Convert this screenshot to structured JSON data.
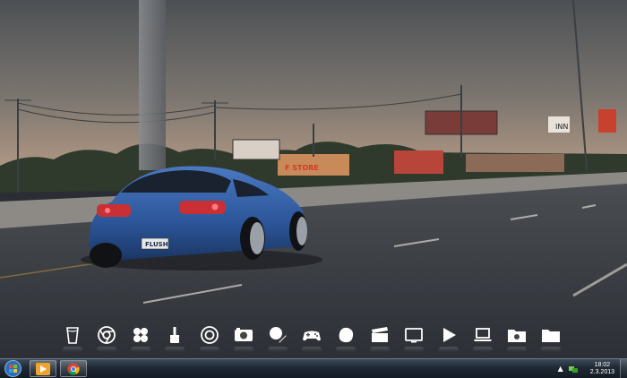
{
  "wallpaper": {
    "description_icon": "wallpaper-image",
    "signs": {
      "store_sign": "F STORE",
      "billboard_right": "INN",
      "license_plate": "FLUSH"
    }
  },
  "dock": {
    "icons": [
      {
        "name": "recycle-bin-icon"
      },
      {
        "name": "chrome-icon"
      },
      {
        "name": "network-icon"
      },
      {
        "name": "paint-brush-icon"
      },
      {
        "name": "email-icon"
      },
      {
        "name": "camera-icon"
      },
      {
        "name": "edit-icon"
      },
      {
        "name": "gamepad-icon"
      },
      {
        "name": "pebble-icon"
      },
      {
        "name": "clapperboard-icon"
      },
      {
        "name": "monitor-icon"
      },
      {
        "name": "play-icon"
      },
      {
        "name": "laptop-icon"
      },
      {
        "name": "photo-folder-icon"
      },
      {
        "name": "folder-icon"
      }
    ]
  },
  "taskbar": {
    "start_icon": "windows-start-icon",
    "pinned": [
      {
        "name": "media-player-icon"
      },
      {
        "name": "chrome-icon"
      }
    ],
    "tray": {
      "expand_icon": "chevron-up-icon",
      "network_icon": "network-status-icon"
    },
    "clock": {
      "time": "18:02",
      "date": "2.3.2013"
    }
  },
  "colors": {
    "sky_top": "#53575b",
    "sky_horizon": "#b59a86",
    "road": "#3c3f45",
    "car_body": "#2f5a9e",
    "taskbar": "#1f2833"
  }
}
